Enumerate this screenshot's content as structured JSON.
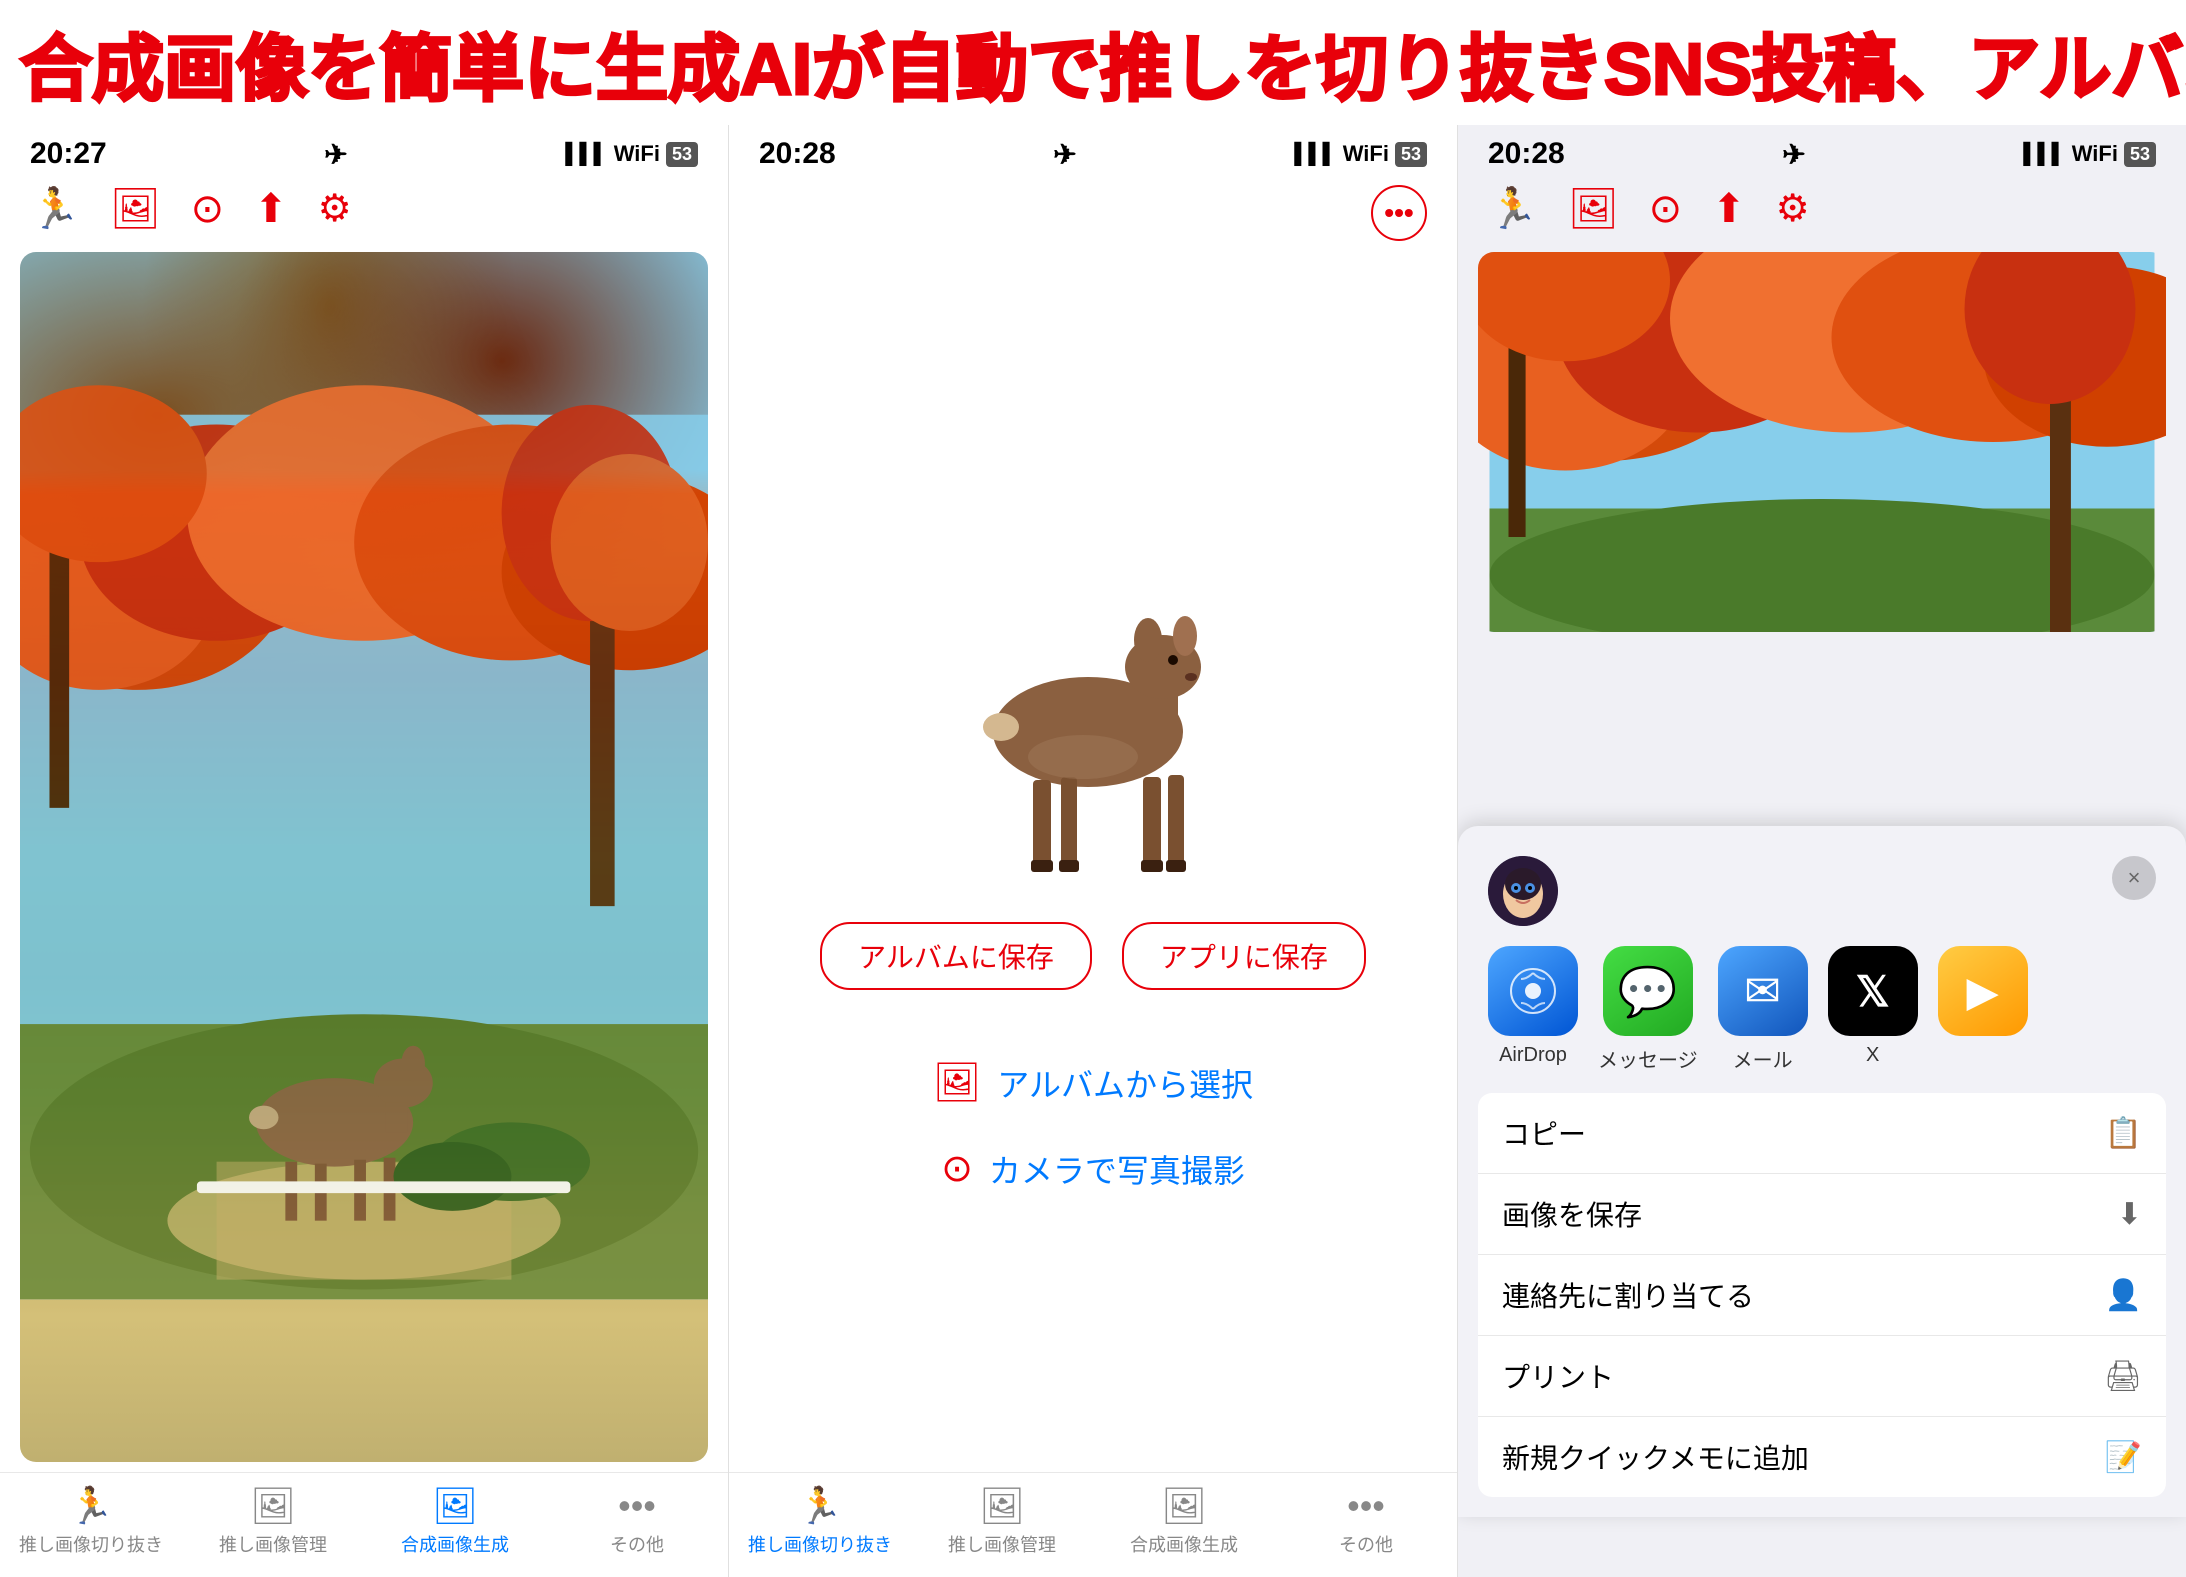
{
  "banner": {
    "text1": "合成画像を簡単に生成",
    "text2": "AIが自動で推しを切り抜き",
    "text3": "SNS投稿、アルバム保存"
  },
  "panel1": {
    "status_time": "20:27",
    "toolbar_icons": [
      "figure-run",
      "photo",
      "camera",
      "share",
      "gear"
    ],
    "nav_items": [
      {
        "label": "推し画像切り抜き",
        "active": false
      },
      {
        "label": "推し画像管理",
        "active": false
      },
      {
        "label": "合成画像生成",
        "active": true
      },
      {
        "label": "その他",
        "active": false
      }
    ]
  },
  "panel2": {
    "status_time": "20:28",
    "toolbar_icons": [
      "figure-run",
      "photo",
      "camera",
      "share",
      "gear"
    ],
    "more_icon_label": "•••",
    "btn_save_album": "アルバムに保存",
    "btn_save_app": "アプリに保存",
    "menu_album": "アルバムから選択",
    "menu_camera": "カメラで写真撮影",
    "nav_items": [
      {
        "label": "推し画像切り抜き",
        "active": true
      },
      {
        "label": "推し画像管理",
        "active": false
      },
      {
        "label": "合成画像生成",
        "active": false
      },
      {
        "label": "その他",
        "active": false
      }
    ]
  },
  "panel3": {
    "status_time": "20:28",
    "toolbar_icons": [
      "figure-run",
      "photo",
      "camera",
      "share",
      "gear"
    ],
    "share_sheet": {
      "close_label": "×",
      "apps": [
        {
          "name": "AirDrop",
          "type": "airdrop"
        },
        {
          "name": "メッセージ",
          "type": "messages"
        },
        {
          "name": "メール",
          "type": "mail"
        },
        {
          "name": "X",
          "type": "x-app"
        },
        {
          "name": "",
          "type": "more-apps"
        }
      ],
      "actions": [
        {
          "label": "コピー",
          "icon": "📋"
        },
        {
          "label": "画像を保存",
          "icon": "⬇"
        },
        {
          "label": "連絡先に割り当てる",
          "icon": "👤"
        },
        {
          "label": "プリント",
          "icon": "🖨"
        },
        {
          "label": "新規クイックメモに追加",
          "icon": "📝"
        }
      ]
    }
  }
}
